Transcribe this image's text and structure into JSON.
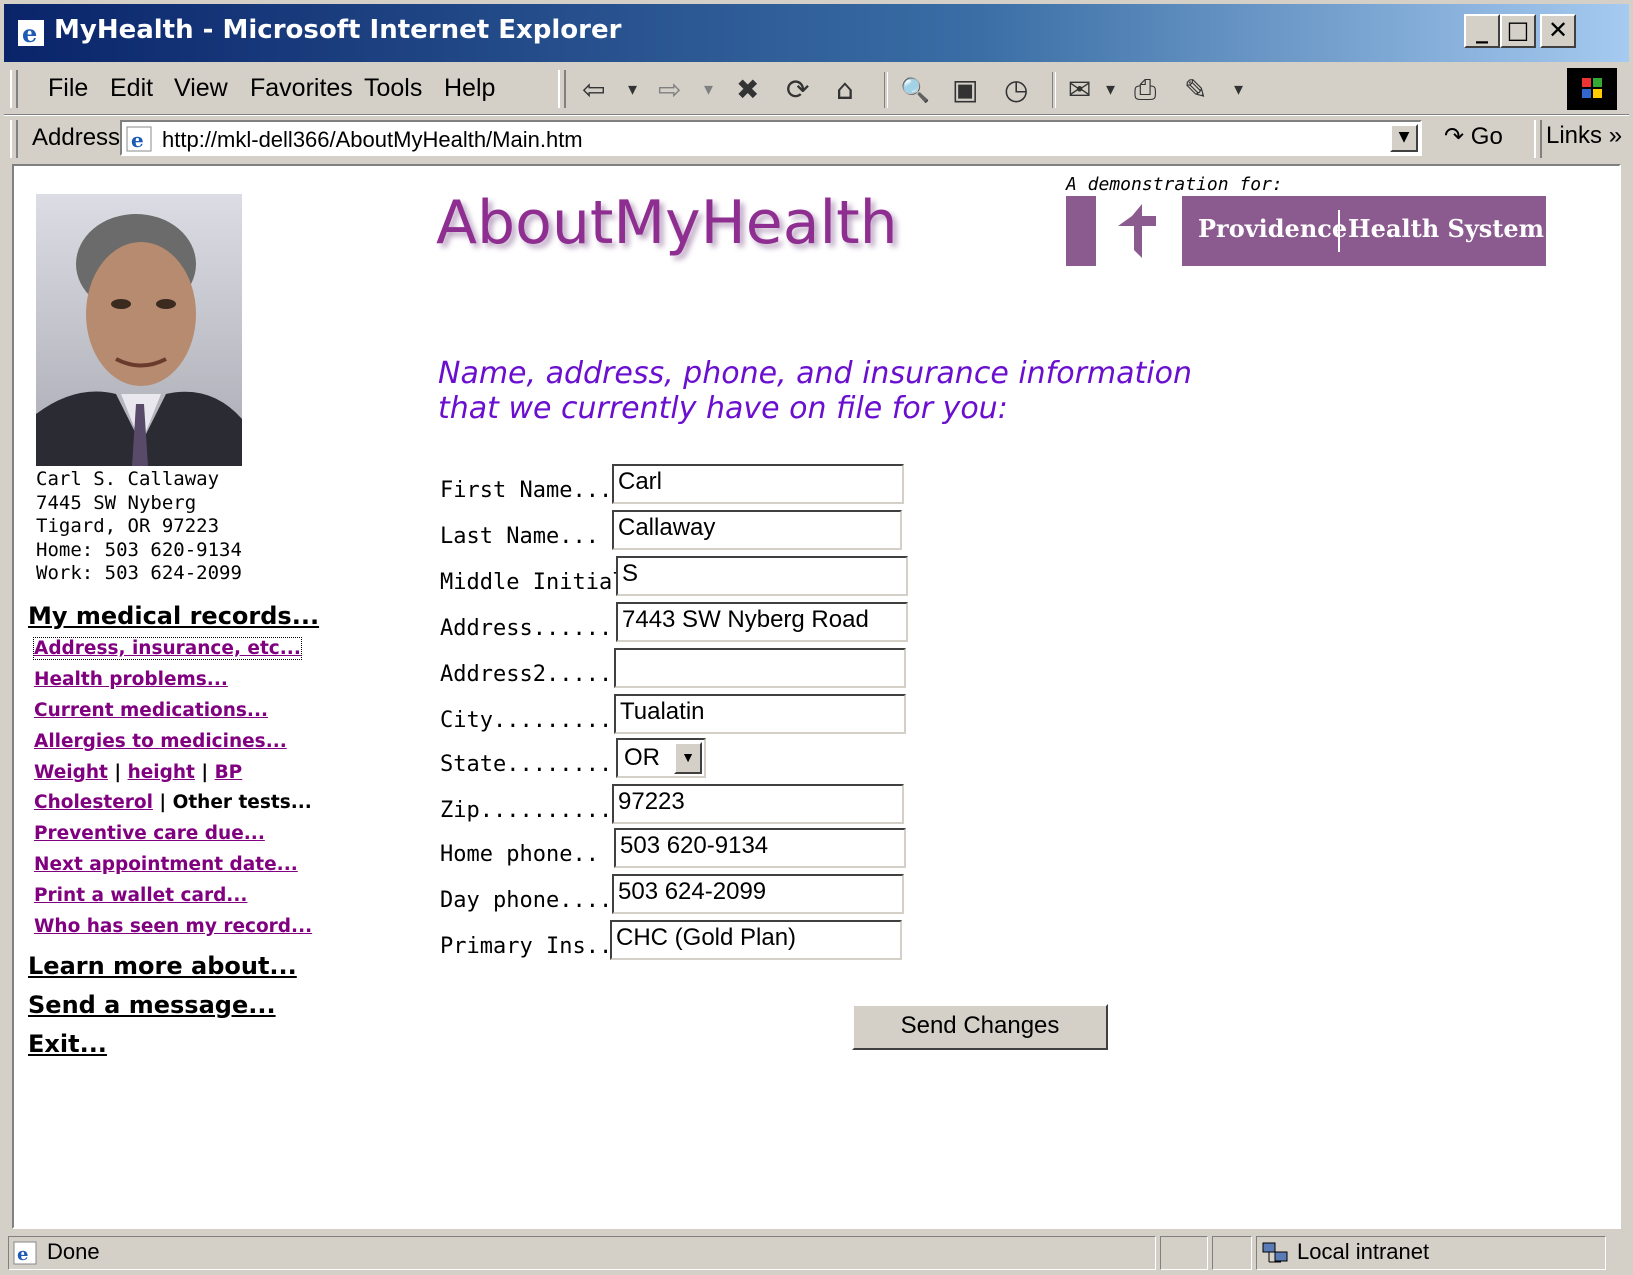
{
  "window": {
    "title": "MyHealth - Microsoft Internet Explorer",
    "minimize": "_",
    "maximize": "□",
    "close": "✕"
  },
  "menu": {
    "items": [
      "File",
      "Edit",
      "View",
      "Favorites",
      "Tools",
      "Help"
    ]
  },
  "toolbar": {
    "back": "⇦",
    "forward": "⇨",
    "stop": "✖",
    "refresh": "⟳",
    "home": "⌂",
    "search": "🔍",
    "favorites": "▣",
    "history": "◷",
    "mail": "✉",
    "print": "⎙",
    "edit": "✎",
    "dropdown": "▾"
  },
  "addressbar": {
    "label": "Address",
    "url": "http://mkl-dell366/AboutMyHealth/Main.htm",
    "go_label": "Go",
    "links_label": "Links »"
  },
  "patient": {
    "name": "Carl S. Callaway",
    "street": "7445 SW Nyberg",
    "city_line": "Tigard, OR 97223",
    "home": "Home: 503 620-9134",
    "work": "Work: 503 624-2099"
  },
  "nav": {
    "records_heading": "My medical records...",
    "links": [
      "Address, insurance, etc...",
      "Health problems...",
      "Current medications...",
      "Allergies to medicines..."
    ],
    "weight": "Weight",
    "height": "height",
    "bp": "BP",
    "pipe": "|",
    "cholesterol": "Cholesterol",
    "other_tests": "Other tests...",
    "links2": [
      "Preventive care due...",
      "Next appointment date...",
      "Print a wallet card...",
      "Who has seen my record..."
    ],
    "learn_more": "Learn more about...",
    "send_message": "Send a message...",
    "exit": "Exit..."
  },
  "brand": {
    "title": "AboutMyHealth",
    "demo_label": "A demonstration for:",
    "org_part1": "Providence",
    "org_part2": "Health System"
  },
  "form": {
    "heading_line1": "Name, address, phone, and insurance information",
    "heading_line2": "that we currently have on file for you:",
    "fields": [
      {
        "label": "First Name...",
        "value": "Carl"
      },
      {
        "label": "Last Name...",
        "value": "Callaway"
      },
      {
        "label": "Middle Initial.",
        "value": "S"
      },
      {
        "label": "Address.......",
        "value": "7443 SW Nyberg Road"
      },
      {
        "label": "Address2.....",
        "value": ""
      },
      {
        "label": "City............",
        "value": "Tualatin"
      },
      {
        "label": "State..........",
        "value": "OR"
      },
      {
        "label": "Zip..............",
        "value": "97223"
      },
      {
        "label": "Home phone..",
        "value": "503 620-9134"
      },
      {
        "label": "Day phone....",
        "value": "503 624-2099"
      },
      {
        "label": "Primary Ins...",
        "value": "CHC (Gold Plan)"
      }
    ],
    "submit_label": "Send Changes"
  },
  "status": {
    "text": "Done",
    "zone": "Local intranet"
  },
  "colors": {
    "title_bar": "#0a246a",
    "brand_purple": "#8e2e91",
    "heading_purple": "#6a0fcf",
    "visited_link": "#800080",
    "logo_purple": "#8b5a8f"
  }
}
